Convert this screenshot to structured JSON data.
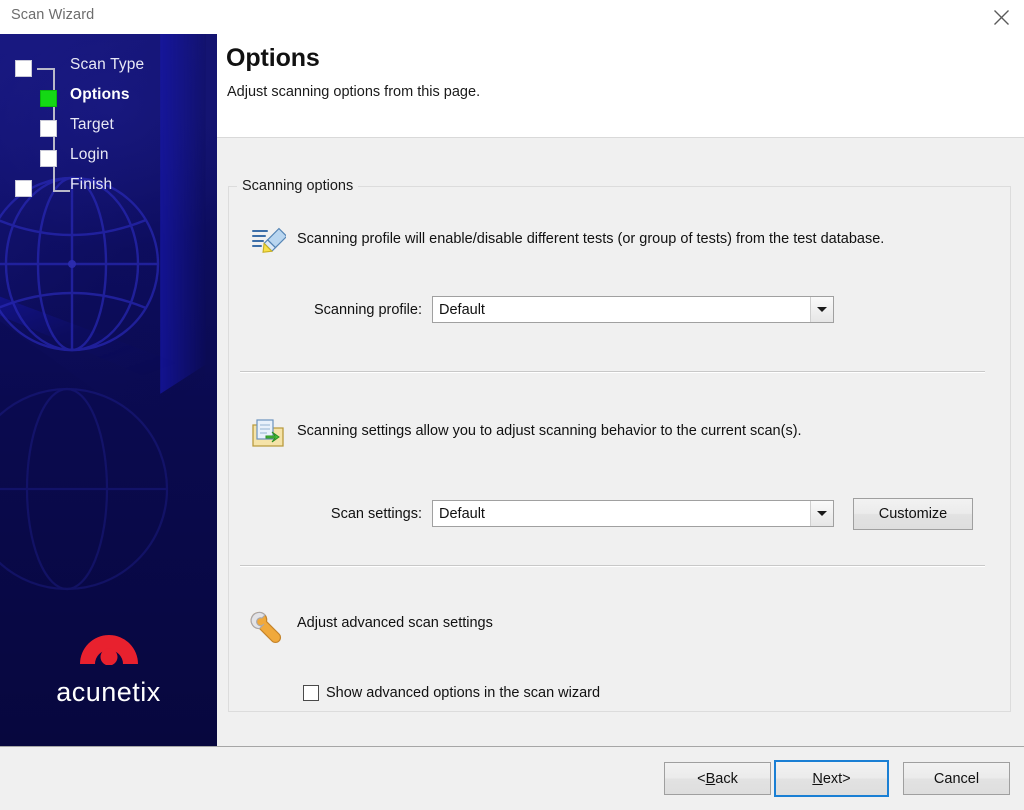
{
  "window": {
    "title": "Scan Wizard",
    "close_icon": "close-icon"
  },
  "sidebar": {
    "steps": [
      {
        "label": "Scan Type",
        "state": "done",
        "level": "outer"
      },
      {
        "label": "Options",
        "state": "current",
        "level": "inner"
      },
      {
        "label": "Target",
        "state": "pending",
        "level": "inner"
      },
      {
        "label": "Login",
        "state": "pending",
        "level": "inner"
      },
      {
        "label": "Finish",
        "state": "pending",
        "level": "outer"
      }
    ],
    "brand": {
      "name": "acunetix",
      "mark_icon": "acunetix-arc-logo-icon",
      "mark_color": "#e8212e"
    },
    "background_color": "#0a0a4a",
    "current_step_color": "#14d814"
  },
  "page": {
    "title": "Options",
    "subtitle": "Adjust scanning options from this page."
  },
  "groupbox": {
    "title": "Scanning options"
  },
  "sections": [
    {
      "icon": "pencil-list-icon",
      "description": "Scanning profile will enable/disable different tests (or group of tests) from the test database.",
      "field_label": "Scanning profile:",
      "field_value": "Default",
      "field_placeholder": "Default"
    },
    {
      "icon": "folder-sync-icon",
      "description": "Scanning settings allow you to adjust scanning behavior to the current scan(s).",
      "field_label": "Scan settings:",
      "field_value": "Default",
      "field_placeholder": "Default",
      "button_label": "Customize"
    },
    {
      "icon": "wrench-icon",
      "description": "Adjust advanced scan settings",
      "checkbox_label": "Show advanced options in the scan wizard",
      "checkbox_checked": false
    }
  ],
  "footer": {
    "back": {
      "prefix": "< ",
      "accel": "B",
      "rest": "ack",
      "suffix": ""
    },
    "next": {
      "prefix": "",
      "accel": "N",
      "rest": "ext",
      "suffix": " >"
    },
    "cancel": {
      "label": "Cancel"
    },
    "default_button": "next",
    "focus_color": "#1a7fd4"
  }
}
